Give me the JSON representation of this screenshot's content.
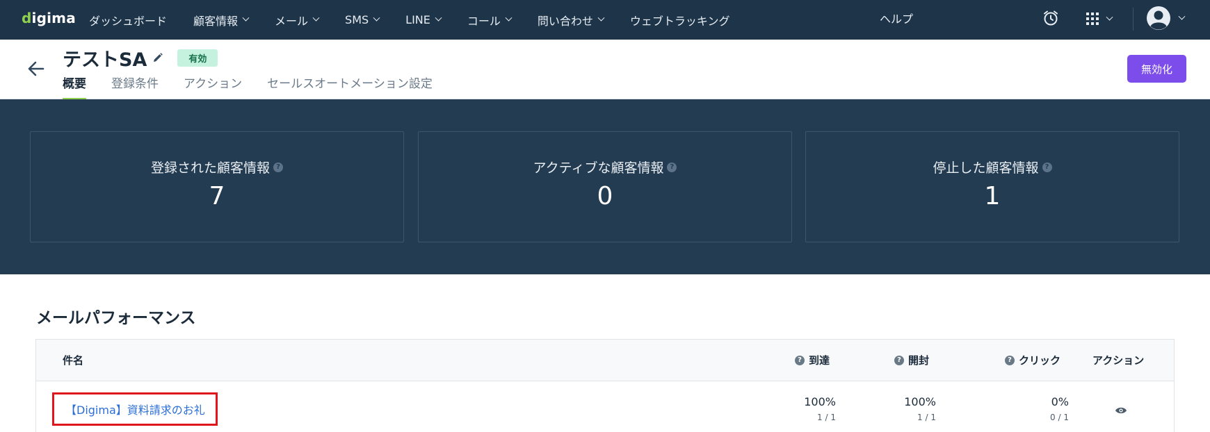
{
  "nav": {
    "logo_d": "d",
    "logo_rest": "igima",
    "items": [
      {
        "label": "ダッシュボード",
        "has_dropdown": false
      },
      {
        "label": "顧客情報",
        "has_dropdown": true
      },
      {
        "label": "メール",
        "has_dropdown": true
      },
      {
        "label": "SMS",
        "has_dropdown": true
      },
      {
        "label": "LINE",
        "has_dropdown": true
      },
      {
        "label": "コール",
        "has_dropdown": true
      },
      {
        "label": "問い合わせ",
        "has_dropdown": true
      },
      {
        "label": "ウェブトラッキング",
        "has_dropdown": false
      }
    ],
    "help": "ヘルプ",
    "icons": [
      "alarm-clock-icon",
      "apps-grid-icon",
      "user-avatar-icon"
    ]
  },
  "header": {
    "title": "テストSA",
    "status": "有効",
    "tabs": [
      "概要",
      "登録条件",
      "アクション",
      "セールスオートメーション設定"
    ],
    "active_tab": "概要",
    "disable_button": "無効化"
  },
  "stats": [
    {
      "label": "登録された顧客情報",
      "value": "7"
    },
    {
      "label": "アクティブな顧客情報",
      "value": "0"
    },
    {
      "label": "停止した顧客情報",
      "value": "1"
    }
  ],
  "mail_performance": {
    "title": "メールパフォーマンス",
    "columns": {
      "subject": "件名",
      "delivered": "到達",
      "opened": "開封",
      "clicked": "クリック",
      "action": "アクション"
    },
    "rows": [
      {
        "subject": "【Digima】資料請求のお礼",
        "delivered_pct": "100%",
        "delivered_count": "1 / 1",
        "opened_pct": "100%",
        "opened_count": "1 / 1",
        "clicked_pct": "0%",
        "clicked_count": "0 / 1"
      }
    ]
  },
  "colors": {
    "nav_bg": "#1d3449",
    "stats_bg": "#233c52",
    "accent_green": "#8fd14f",
    "primary_purple": "#7c4dea",
    "link_blue": "#2b6fd6",
    "highlight_red": "#e0161d"
  }
}
